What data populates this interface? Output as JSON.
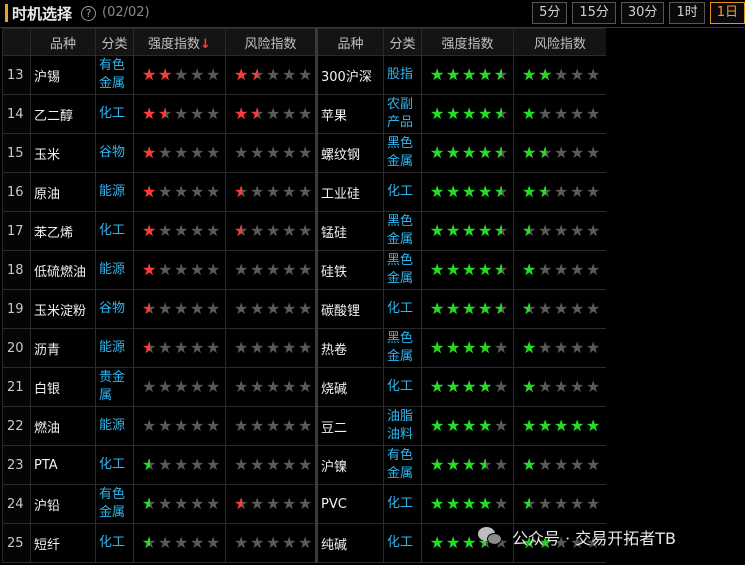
{
  "header": {
    "title": "时机选择",
    "help_icon": "question-circle-icon",
    "date": "(02/02)",
    "periods": [
      "5分",
      "15分",
      "30分",
      "1时",
      "1日"
    ],
    "active_period": "1日",
    "accent_color": "#f0a020"
  },
  "columns": {
    "variety": "品种",
    "category": "分类",
    "strength": "强度指数",
    "strength_sort_icon": "↓",
    "risk": "风险指数"
  },
  "rows": [
    {
      "idx": "13",
      "left": {
        "name": "沪锡",
        "cat": "有色\n金属",
        "strength": 2,
        "risk": 1.5
      },
      "right": {
        "name": "300沪深",
        "cat": "股指",
        "strength": 4.5,
        "risk": 2
      }
    },
    {
      "idx": "14",
      "left": {
        "name": "乙二醇",
        "cat": "化工",
        "strength": 1.5,
        "risk": 1.5
      },
      "right": {
        "name": "苹果",
        "cat": "农副\n产品",
        "strength": 4.5,
        "risk": 1
      }
    },
    {
      "idx": "15",
      "left": {
        "name": "玉米",
        "cat": "谷物",
        "strength": 1,
        "risk": 0
      },
      "right": {
        "name": "螺纹钢",
        "cat": "黑色\n金属",
        "strength": 4.5,
        "risk": 1.5
      }
    },
    {
      "idx": "16",
      "left": {
        "name": "原油",
        "cat": "能源",
        "strength": 1,
        "risk": 0.5
      },
      "right": {
        "name": "工业硅",
        "cat": "化工",
        "strength": 4.5,
        "risk": 1.5
      }
    },
    {
      "idx": "17",
      "left": {
        "name": "苯乙烯",
        "cat": "化工",
        "strength": 1,
        "risk": 0.5
      },
      "right": {
        "name": "锰硅",
        "cat": "黑色\n金属",
        "strength": 4.5,
        "risk": 0.5
      }
    },
    {
      "idx": "18",
      "left": {
        "name": "低硫燃油",
        "cat": "能源",
        "strength": 1,
        "risk": 0
      },
      "right": {
        "name": "硅铁",
        "cat": "黑色\n金属",
        "strength": 4.5,
        "risk": 1
      }
    },
    {
      "idx": "19",
      "left": {
        "name": "玉米淀粉",
        "cat": "谷物",
        "strength": 0.5,
        "risk": 0
      },
      "right": {
        "name": "碳酸锂",
        "cat": "化工",
        "strength": 4.5,
        "risk": 0.5
      }
    },
    {
      "idx": "20",
      "left": {
        "name": "沥青",
        "cat": "能源",
        "strength": 0.5,
        "risk": 0
      },
      "right": {
        "name": "热卷",
        "cat": "黑色\n金属",
        "strength": 4,
        "risk": 1
      }
    },
    {
      "idx": "21",
      "left": {
        "name": "白银",
        "cat": "贵金\n属",
        "strength": 0,
        "risk": 0
      },
      "right": {
        "name": "烧碱",
        "cat": "化工",
        "strength": 4,
        "risk": 1
      }
    },
    {
      "idx": "22",
      "left": {
        "name": "燃油",
        "cat": "能源",
        "strength": 0,
        "risk": 0
      },
      "right": {
        "name": "豆二",
        "cat": "油脂\n油料",
        "strength": 4,
        "risk": 5
      }
    },
    {
      "idx": "23",
      "left": {
        "name": "PTA",
        "cat": "化工",
        "strength": -0.5,
        "risk": 0
      },
      "right": {
        "name": "沪镍",
        "cat": "有色\n金属",
        "strength": 3.5,
        "risk": 1
      }
    },
    {
      "idx": "24",
      "left": {
        "name": "沪铅",
        "cat": "有色\n金属",
        "strength": -0.5,
        "risk": 0.5
      },
      "right": {
        "name": "PVC",
        "cat": "化工",
        "strength": 4,
        "risk": 0.5
      }
    },
    {
      "idx": "25",
      "left": {
        "name": "短纤",
        "cat": "化工",
        "strength": -0.5,
        "risk": 0
      },
      "right": {
        "name": "纯碱",
        "cat": "化工",
        "strength": 3.5,
        "risk": 2
      }
    }
  ],
  "star_colors": {
    "red": "#ff3838",
    "green": "#21e021",
    "empty": "#5a5a5a"
  },
  "watermark": {
    "icon": "wechat-icon",
    "text": "公众号 · 交易开拓者TB"
  }
}
